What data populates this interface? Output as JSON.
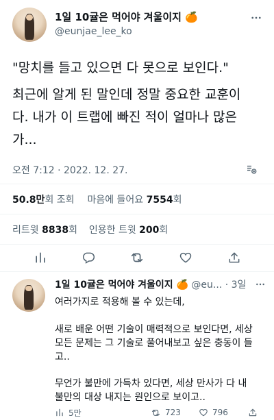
{
  "main_tweet": {
    "author_name": "1일 10귤은 먹어야 겨울이지 🍊",
    "author_handle": "@eunjae_lee_ko",
    "text_line1": "\"망치를 들고 있으면 다 못으로 보인다.\"",
    "text_line2": "최근에 알게 된 말인데 정말 중요한 교훈이",
    "text_line3": "다. 내가 이 트랩에 빠진 적이 얼마나 많은",
    "text_line4": "가...",
    "timestamp": "오전 7:12 · 2022. 12. 27.",
    "views": {
      "number": "50.8만",
      "unit": "회",
      "label": "조회"
    },
    "likes": {
      "label": "마음에 들어요",
      "number": "7554",
      "unit": "회"
    },
    "retweets": {
      "label": "리트윗",
      "number": "8838",
      "unit": "회"
    },
    "quotes": {
      "label": "인용한 트윗",
      "number": "200",
      "unit": "회"
    }
  },
  "reply": {
    "author_name": "1일 10귤은 먹어야 겨울이지 🍊",
    "author_handle": "@eu...",
    "time": "· 3일",
    "line1": "여러가지로 적용해 볼 수 있는데,",
    "line2": "새로 배운 어떤 기술이 매력적으로 보인다면, 세상",
    "line3": "모든 문제는 그 기술로 풀어내보고 싶은 충동이 들",
    "line4": "고..",
    "line5": "무언가 불만에 가득차 있다면, 세상 만사가 다 내",
    "line6": "불만의 대상 내지는 원인으로 보이고..",
    "views_count": "5만",
    "retweet_count": "723",
    "like_count": "796"
  },
  "icons": [
    "more-icon",
    "bookmark-save-icon",
    "analytics-icon",
    "reply-icon",
    "retweet-icon",
    "like-icon",
    "share-icon"
  ]
}
